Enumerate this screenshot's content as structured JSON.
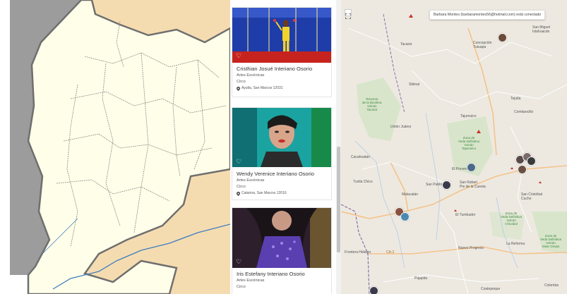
{
  "cards": [
    {
      "name": "Cristhian Josué Interiano Osorio",
      "category": "Artes Escénicas",
      "subcategory": "Circo",
      "location": "Ayutla, San Marcos 12031"
    },
    {
      "name": "Wendy Verenice Interiano Osorio",
      "category": "Artes Escénicas",
      "subcategory": "Circo",
      "location": "Catarina, San Marcos 12016"
    },
    {
      "name": "Iris Estefany Interiano Osorio",
      "category": "Artes Escénicas",
      "subcategory": "Circo",
      "location": ""
    }
  ],
  "notification": "Barbara Montes (barbaramontes56@hotmail.com) está conectado",
  "map_labels": {
    "tacana": "Tacaná",
    "sibinal": "Sibinal",
    "san_miguel": "San Miguel\nIxtahuacán",
    "concepcion": "Concepción\nTutuapa",
    "tajumulco": "Tajumulco",
    "tejutla": "Tejutla",
    "comitancillo": "Comitancillo",
    "union_juarez": "Unión Juárez",
    "cacahoatan": "Cacahoatán",
    "el_porvenir": "El Porvenir",
    "san_pablo": "San Pablo",
    "san_rafael": "San Rafael\nPie de la Cuesta",
    "tuxtla_chico": "Tuxtla Chico",
    "malacatan": "Malacatán",
    "san_cristobal": "San Cristóbal\nCucho",
    "el_tumbador": "El Tumbador",
    "nuevo_progreso": "Nuevo Progreso",
    "la_reforma": "La Reforma",
    "frontera_hidalgo": "Frontera Hidalgo",
    "pajapita": "Pajapita",
    "coatepeque": "Coatepeque",
    "colomba": "Colomba",
    "ca2": "CA-2",
    "reserva_biosfera": "Reserva\nde la Biosfera\nVolcán\nTacaná",
    "zona_tajumulco": "Zona de\nVeda Definitiva\nVolcán\nTajumulco",
    "zona_cuchumatanes": "Zona de\nVeda Definitiva\nVolcán\nSiete Orejas",
    "zona_coatepeque": "Zona de\nVeda Definitiva\nVolcán\nChicabal"
  },
  "colors": {
    "ocean": "#9c9c9c",
    "land_yellow": "#ffffe9",
    "neighbor_tan": "#f5dcb0",
    "border": "#6f6f6f",
    "river": "#3d7dbf",
    "map_bg": "#ede9e1",
    "park_green": "#cfe3c2",
    "road": "#f5c38a"
  },
  "icons": [
    "heart-icon",
    "location-pin-icon",
    "fullscreen-icon"
  ]
}
